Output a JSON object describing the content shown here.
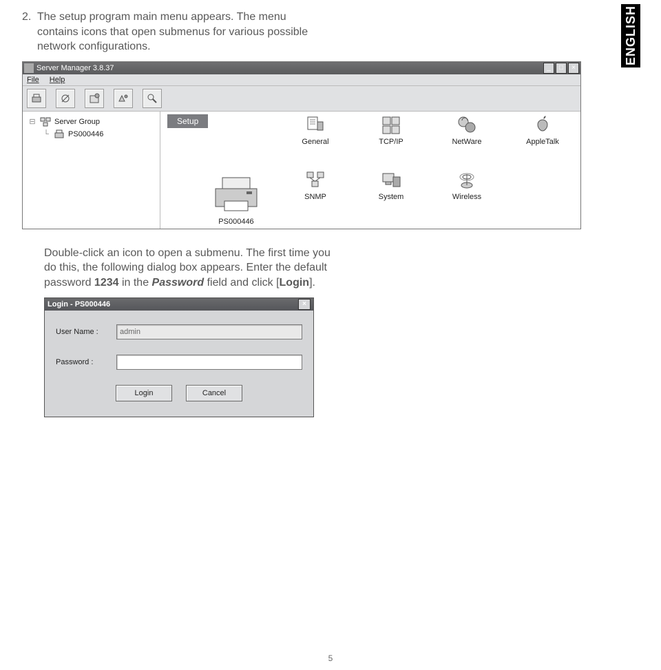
{
  "language_tab": "ENGLISH",
  "step": {
    "number": "2.",
    "line1": "The setup program main menu appears.",
    "rest": "The menu contains icons that open submenus for various possible network configurations."
  },
  "server_manager": {
    "title": "Server Manager 3.8.37",
    "menu": {
      "file": "File",
      "help": "Help"
    },
    "win_buttons": {
      "min": "_",
      "max": "□",
      "close": "×"
    },
    "tree": {
      "group": "Server Group",
      "server": "PS000446"
    },
    "setup_tab": "Setup",
    "icons": {
      "general": "General",
      "tcpip": "TCP/IP",
      "netware": "NetWare",
      "appletalk": "AppleTalk",
      "ps": "PS000446",
      "snmp": "SNMP",
      "system": "System",
      "wireless": "Wireless"
    }
  },
  "mid_text": {
    "p1": "Double-click an icon to open a submenu.",
    "p2a": "The first time you do this, the following dialog box appears. Enter the default password ",
    "p2b_bold": "1234",
    "p2c": " in the ",
    "p2d_em": "Password",
    "p2e": " field and click [",
    "p2f_bold": "Login",
    "p2g": "]."
  },
  "login_dialog": {
    "title": "Login - PS000446",
    "close": "×",
    "user_label": "User Name :",
    "user_value": "admin",
    "pass_label": "Password :",
    "pass_value": "",
    "btn_login": "Login",
    "btn_cancel": "Cancel"
  },
  "page_number": "5"
}
